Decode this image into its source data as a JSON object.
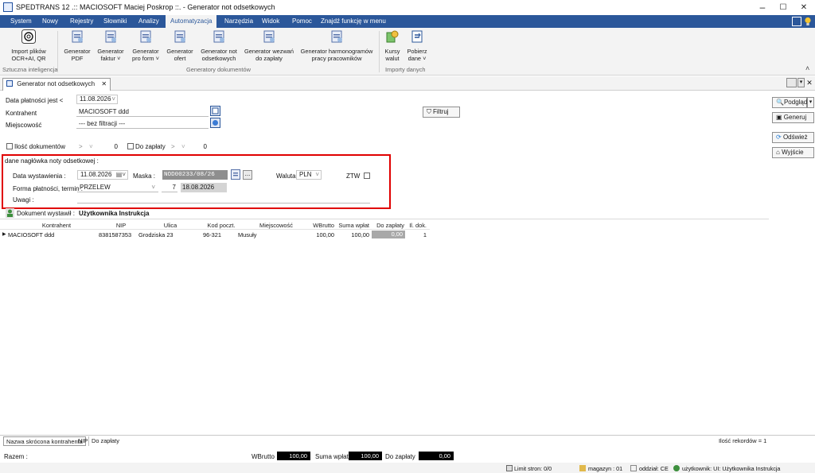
{
  "window": {
    "title": "SPEDTRANS 12 .:: MACIOSOFT Maciej Poskrop ::. - Generator not odsetkowych",
    "minimize": "–",
    "maximize": "☐",
    "close": "✕"
  },
  "menu": {
    "tabs": [
      "System",
      "Nowy",
      "Rejestry",
      "Słowniki",
      "Analizy",
      "Automatyzacja",
      "Narzędzia",
      "Widok",
      "Pomoc"
    ],
    "active_tab": "Automatyzacja",
    "find": "Znajdź funkcję w menu"
  },
  "ribbon": {
    "buttons": [
      {
        "label1": "Import plików",
        "label2": "OCR+AI, QR",
        "icon": "openai-icon"
      },
      {
        "label1": "Generator",
        "label2": "PDF",
        "icon": "pdf-generator-icon"
      },
      {
        "label1": "Generator",
        "label2": "faktur ˅",
        "icon": "invoice-generator-icon"
      },
      {
        "label1": "Generator",
        "label2": "pro form ˅",
        "icon": "proforma-generator-icon"
      },
      {
        "label1": "Generator",
        "label2": "ofert",
        "icon": "offer-generator-icon"
      },
      {
        "label1": "Generator not",
        "label2": "odsetkowych",
        "icon": "interest-note-generator-icon"
      },
      {
        "label1": "Generator wezwań",
        "label2": "do zapłaty",
        "icon": "payment-demand-generator-icon"
      },
      {
        "label1": "Generator harmonogramów",
        "label2": "pracy pracowników",
        "icon": "schedule-generator-icon"
      },
      {
        "label1": "Kursy",
        "label2": "walut",
        "icon": "currency-rates-icon"
      },
      {
        "label1": "Pobierz",
        "label2": "dane ˅",
        "icon": "download-data-icon"
      }
    ],
    "groups": [
      "Sztuczna inteligencja",
      "Generatory dokumentów",
      "Importy danych"
    ],
    "collapse": "˄"
  },
  "doc_tab": {
    "label": "Generator not odsetkowych",
    "close": "✕"
  },
  "filters": {
    "due_date_label": "Data płatności jest <",
    "due_date_value": "11.08.2026",
    "contractor_label": "Kontrahent",
    "contractor_value": "MACIOSOFT ddd",
    "city_label": "Miejscowość",
    "city_value": "--- bez filtracji ---",
    "doc_count_label": "Ilość dokumentów",
    "doc_count_op": ">",
    "doc_count_value": "0",
    "to_pay_label": "Do zapłaty",
    "to_pay_op": ">",
    "to_pay_value": "0",
    "filter_button": "Filtruj"
  },
  "header_section": {
    "title": "dane nagłówka noty odsetkowej :",
    "issue_date_label": "Data wystawienia :",
    "issue_date_value": "11.08.2026",
    "mask_label": "Maska :",
    "mask_value": "NOD00233/08/26",
    "ellipsis": "...",
    "currency_label": "Waluta",
    "currency_value": "PLN",
    "ztw_label": "ZTW",
    "payment_label": "Forma płatności, termin :",
    "payment_value": "PRZELEW",
    "term_days": "7",
    "term_date": "18.08.2026",
    "notes_label": "Uwagi :",
    "notes_value": ""
  },
  "issued_by": {
    "label": "Dokument wystawił :",
    "value": "Użytkownika Instrukcja"
  },
  "grid": {
    "columns": [
      "Kontrahent",
      "NIP",
      "Ulica",
      "Kod poczt.",
      "Miejscowość",
      "WBrutto",
      "Suma wpłat",
      "Do zapłaty",
      "Il. dok."
    ],
    "rows": [
      {
        "kontrahent": "MACIOSOFT ddd",
        "nip": "8381587353",
        "ulica": "Grodziska 23",
        "kod": "96-321",
        "miejscowosc": "Musuły",
        "wbrutto": "100,00",
        "suma": "100,00",
        "dozaplaty": "0,00",
        "ildok": "1"
      }
    ],
    "row_marker": "▶"
  },
  "side_buttons": {
    "preview": "Podgląd",
    "generate": "Generuj",
    "refresh": "Odśwież",
    "exit": "Wyjście"
  },
  "bottom_tabs": [
    "Nazwa skrócona kontrahenta",
    "NIP",
    "Do zapłaty"
  ],
  "record_count": "Ilość rekordów = 1",
  "totals": {
    "label": "Razem :",
    "wbrutto_label": "WBrutto",
    "wbrutto_value": "100,00",
    "suma_label": "Suma wpłat",
    "suma_value": "100,00",
    "dozaplaty_label": "Do zapłaty",
    "dozaplaty_value": "0,00"
  },
  "status": {
    "limit": "Limit stron: 0/0",
    "magazyn": "magazyn : 01",
    "oddzial": "oddział: CE",
    "user": "użytkownik: UI: Użytkownika Instrukcja"
  },
  "colors": {
    "menubar": "#2b579a",
    "highlight": "#e00000",
    "active_tab_text": "#2b579a"
  }
}
